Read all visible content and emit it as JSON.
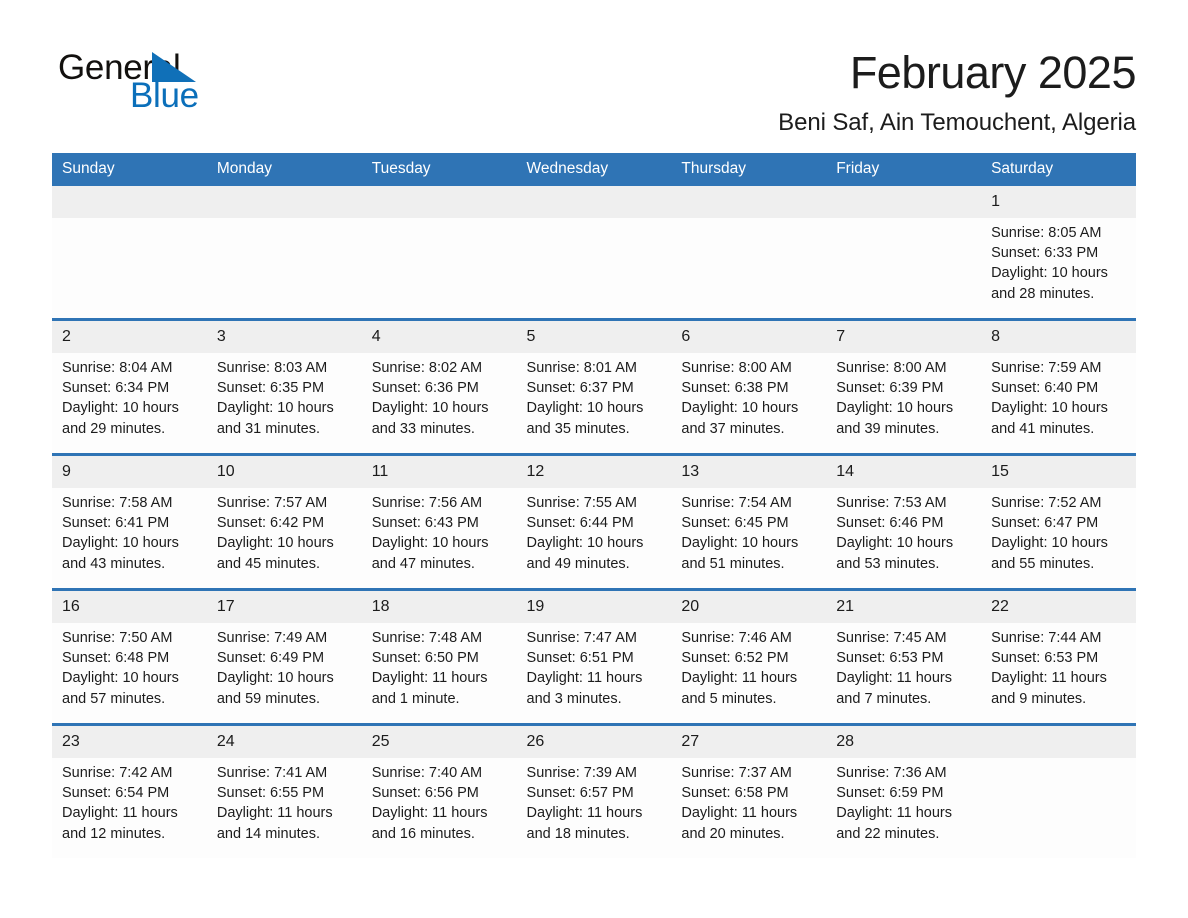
{
  "brand": {
    "name_part1": "General",
    "name_part2": "Blue",
    "accent_color": "#0b6fba",
    "logo_icon": "triangle-icon"
  },
  "header": {
    "title": "February 2025",
    "subtitle": "Beni Saf, Ain Temouchent, Algeria"
  },
  "theme": {
    "header_row_color": "#2f74b5",
    "day_band_color": "#efefef",
    "cell_color": "#fdfdfd"
  },
  "weekday_headers": [
    "Sunday",
    "Monday",
    "Tuesday",
    "Wednesday",
    "Thursday",
    "Friday",
    "Saturday"
  ],
  "weeks": [
    [
      {
        "day": "",
        "empty": true
      },
      {
        "day": "",
        "empty": true
      },
      {
        "day": "",
        "empty": true
      },
      {
        "day": "",
        "empty": true
      },
      {
        "day": "",
        "empty": true
      },
      {
        "day": "",
        "empty": true
      },
      {
        "day": "1",
        "sunrise": "Sunrise: 8:05 AM",
        "sunset": "Sunset: 6:33 PM",
        "daylight": "Daylight: 10 hours and 28 minutes."
      }
    ],
    [
      {
        "day": "2",
        "sunrise": "Sunrise: 8:04 AM",
        "sunset": "Sunset: 6:34 PM",
        "daylight": "Daylight: 10 hours and 29 minutes."
      },
      {
        "day": "3",
        "sunrise": "Sunrise: 8:03 AM",
        "sunset": "Sunset: 6:35 PM",
        "daylight": "Daylight: 10 hours and 31 minutes."
      },
      {
        "day": "4",
        "sunrise": "Sunrise: 8:02 AM",
        "sunset": "Sunset: 6:36 PM",
        "daylight": "Daylight: 10 hours and 33 minutes."
      },
      {
        "day": "5",
        "sunrise": "Sunrise: 8:01 AM",
        "sunset": "Sunset: 6:37 PM",
        "daylight": "Daylight: 10 hours and 35 minutes."
      },
      {
        "day": "6",
        "sunrise": "Sunrise: 8:00 AM",
        "sunset": "Sunset: 6:38 PM",
        "daylight": "Daylight: 10 hours and 37 minutes."
      },
      {
        "day": "7",
        "sunrise": "Sunrise: 8:00 AM",
        "sunset": "Sunset: 6:39 PM",
        "daylight": "Daylight: 10 hours and 39 minutes."
      },
      {
        "day": "8",
        "sunrise": "Sunrise: 7:59 AM",
        "sunset": "Sunset: 6:40 PM",
        "daylight": "Daylight: 10 hours and 41 minutes."
      }
    ],
    [
      {
        "day": "9",
        "sunrise": "Sunrise: 7:58 AM",
        "sunset": "Sunset: 6:41 PM",
        "daylight": "Daylight: 10 hours and 43 minutes."
      },
      {
        "day": "10",
        "sunrise": "Sunrise: 7:57 AM",
        "sunset": "Sunset: 6:42 PM",
        "daylight": "Daylight: 10 hours and 45 minutes."
      },
      {
        "day": "11",
        "sunrise": "Sunrise: 7:56 AM",
        "sunset": "Sunset: 6:43 PM",
        "daylight": "Daylight: 10 hours and 47 minutes."
      },
      {
        "day": "12",
        "sunrise": "Sunrise: 7:55 AM",
        "sunset": "Sunset: 6:44 PM",
        "daylight": "Daylight: 10 hours and 49 minutes."
      },
      {
        "day": "13",
        "sunrise": "Sunrise: 7:54 AM",
        "sunset": "Sunset: 6:45 PM",
        "daylight": "Daylight: 10 hours and 51 minutes."
      },
      {
        "day": "14",
        "sunrise": "Sunrise: 7:53 AM",
        "sunset": "Sunset: 6:46 PM",
        "daylight": "Daylight: 10 hours and 53 minutes."
      },
      {
        "day": "15",
        "sunrise": "Sunrise: 7:52 AM",
        "sunset": "Sunset: 6:47 PM",
        "daylight": "Daylight: 10 hours and 55 minutes."
      }
    ],
    [
      {
        "day": "16",
        "sunrise": "Sunrise: 7:50 AM",
        "sunset": "Sunset: 6:48 PM",
        "daylight": "Daylight: 10 hours and 57 minutes."
      },
      {
        "day": "17",
        "sunrise": "Sunrise: 7:49 AM",
        "sunset": "Sunset: 6:49 PM",
        "daylight": "Daylight: 10 hours and 59 minutes."
      },
      {
        "day": "18",
        "sunrise": "Sunrise: 7:48 AM",
        "sunset": "Sunset: 6:50 PM",
        "daylight": "Daylight: 11 hours and 1 minute."
      },
      {
        "day": "19",
        "sunrise": "Sunrise: 7:47 AM",
        "sunset": "Sunset: 6:51 PM",
        "daylight": "Daylight: 11 hours and 3 minutes."
      },
      {
        "day": "20",
        "sunrise": "Sunrise: 7:46 AM",
        "sunset": "Sunset: 6:52 PM",
        "daylight": "Daylight: 11 hours and 5 minutes."
      },
      {
        "day": "21",
        "sunrise": "Sunrise: 7:45 AM",
        "sunset": "Sunset: 6:53 PM",
        "daylight": "Daylight: 11 hours and 7 minutes."
      },
      {
        "day": "22",
        "sunrise": "Sunrise: 7:44 AM",
        "sunset": "Sunset: 6:53 PM",
        "daylight": "Daylight: 11 hours and 9 minutes."
      }
    ],
    [
      {
        "day": "23",
        "sunrise": "Sunrise: 7:42 AM",
        "sunset": "Sunset: 6:54 PM",
        "daylight": "Daylight: 11 hours and 12 minutes."
      },
      {
        "day": "24",
        "sunrise": "Sunrise: 7:41 AM",
        "sunset": "Sunset: 6:55 PM",
        "daylight": "Daylight: 11 hours and 14 minutes."
      },
      {
        "day": "25",
        "sunrise": "Sunrise: 7:40 AM",
        "sunset": "Sunset: 6:56 PM",
        "daylight": "Daylight: 11 hours and 16 minutes."
      },
      {
        "day": "26",
        "sunrise": "Sunrise: 7:39 AM",
        "sunset": "Sunset: 6:57 PM",
        "daylight": "Daylight: 11 hours and 18 minutes."
      },
      {
        "day": "27",
        "sunrise": "Sunrise: 7:37 AM",
        "sunset": "Sunset: 6:58 PM",
        "daylight": "Daylight: 11 hours and 20 minutes."
      },
      {
        "day": "28",
        "sunrise": "Sunrise: 7:36 AM",
        "sunset": "Sunset: 6:59 PM",
        "daylight": "Daylight: 11 hours and 22 minutes."
      },
      {
        "day": "",
        "empty": true
      }
    ]
  ]
}
